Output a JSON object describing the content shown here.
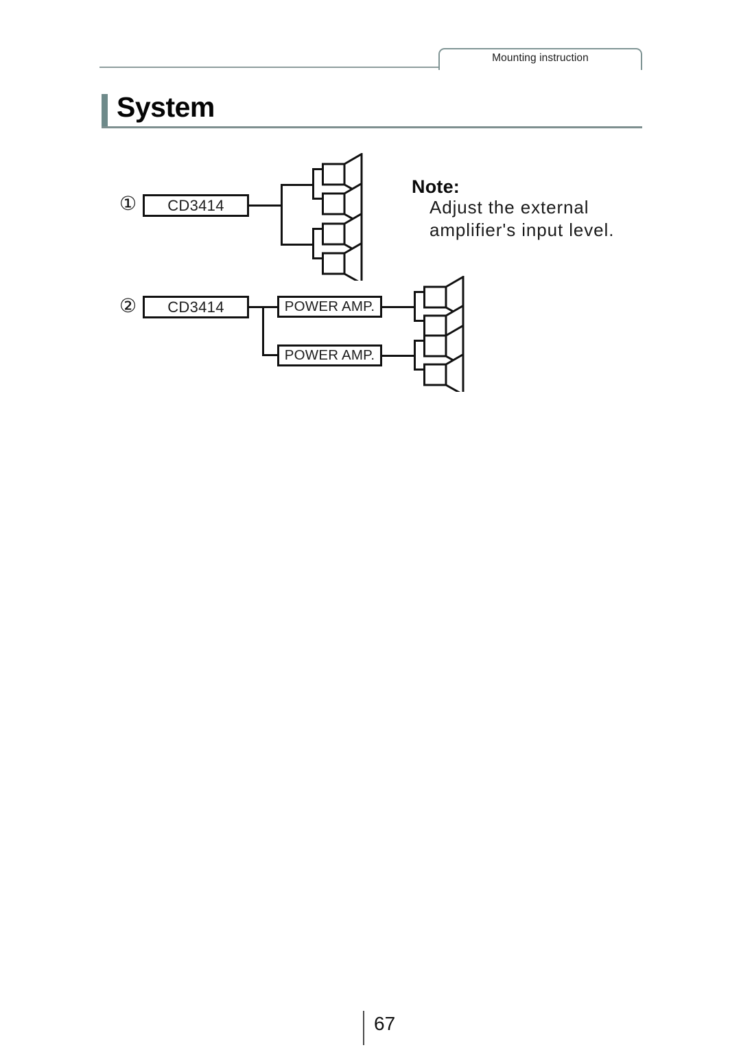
{
  "document": {
    "chapter_tab": "Mounting instruction",
    "page_title": "System",
    "page_number": "67",
    "accent_color": "#6e8a8a",
    "rule_color": "#7d8f8f",
    "line_color": "#111111"
  },
  "note": {
    "title": "Note:",
    "lines": [
      "Adjust the external",
      "amplifier's input level."
    ]
  },
  "diagrams": [
    {
      "marker": "①",
      "source_label": "CD3414",
      "speaker_count": 4,
      "speaker_labels": [
        "speaker",
        "speaker",
        "speaker",
        "speaker"
      ]
    },
    {
      "marker": "②",
      "source_label": "CD3414",
      "amp_labels": [
        "POWER AMP.",
        "POWER AMP."
      ],
      "speaker_count": 4,
      "speaker_labels": [
        "speaker",
        "speaker",
        "speaker",
        "speaker"
      ]
    }
  ]
}
